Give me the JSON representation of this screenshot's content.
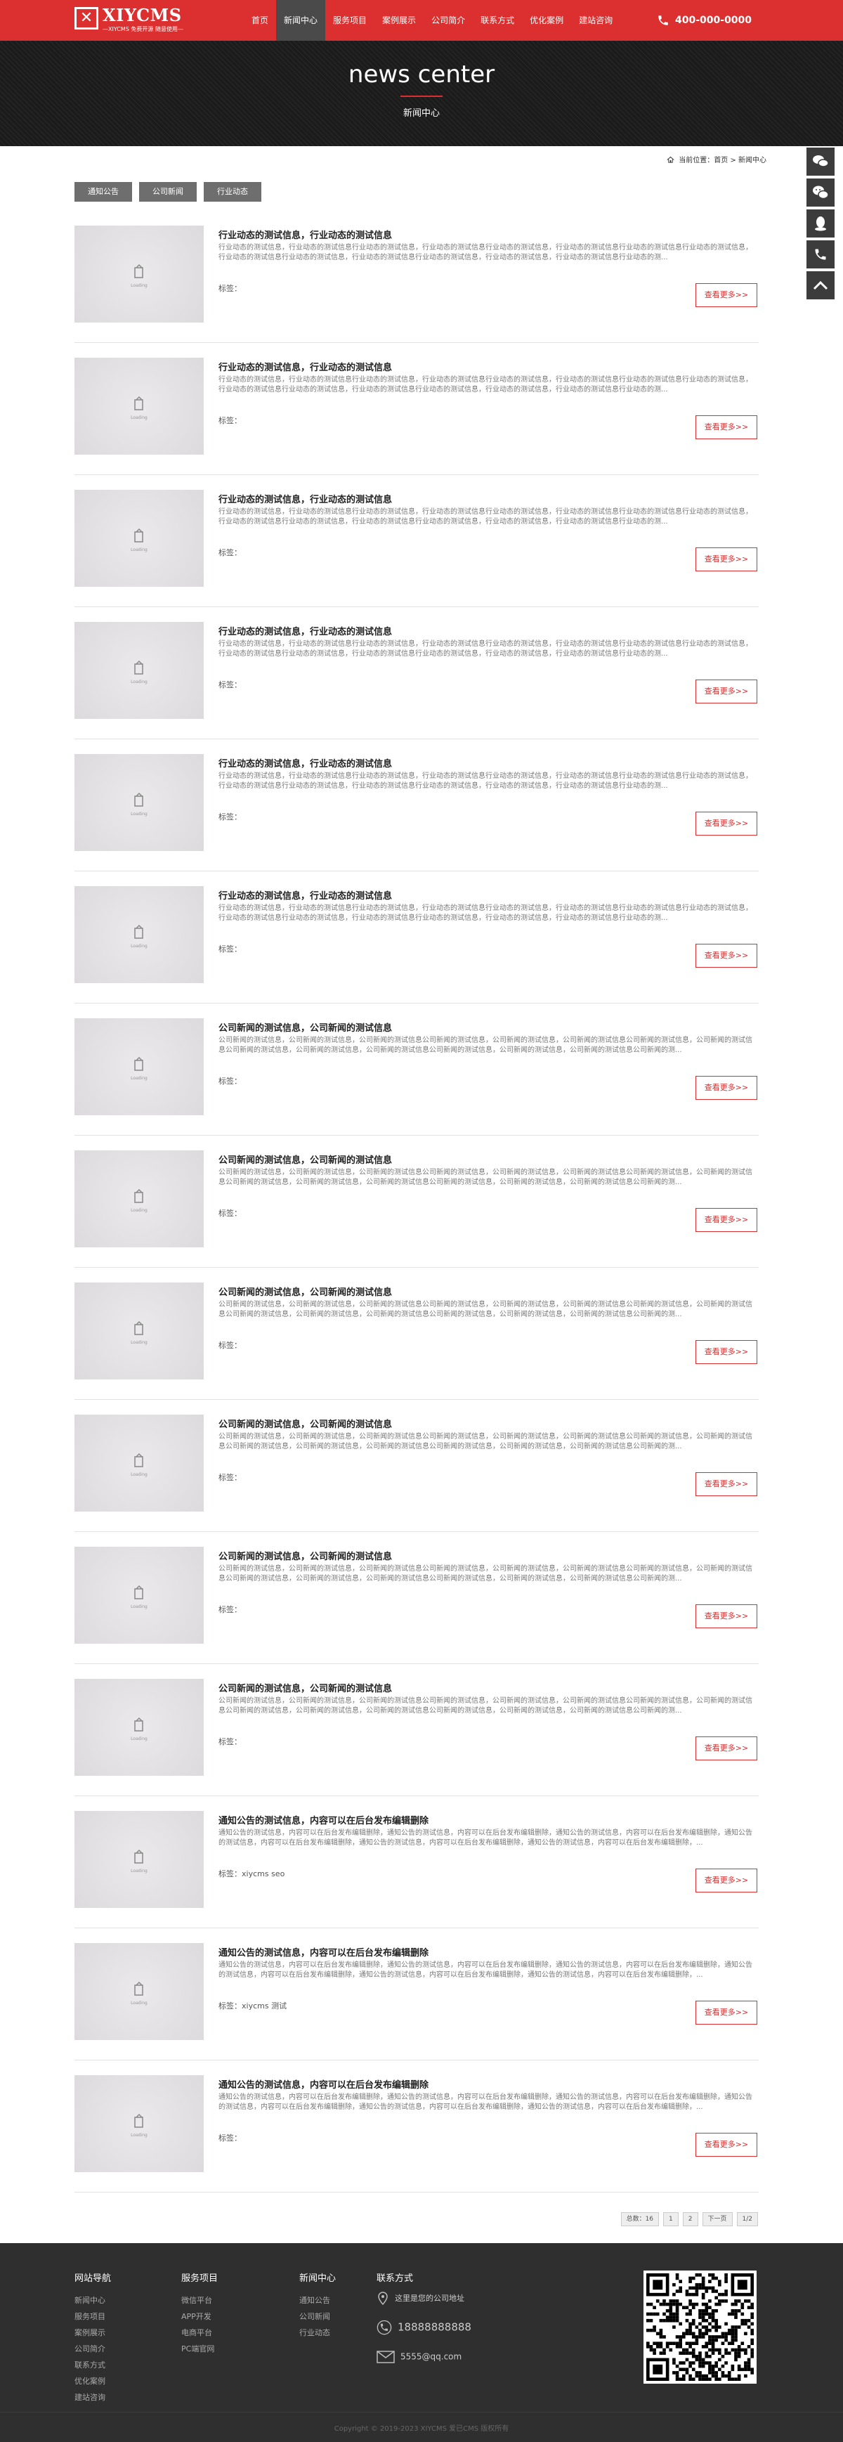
{
  "brand": {
    "logo_text": "XIYCMS",
    "logo_sub": "—XIYCMS 免费开源 随意使用—",
    "accent": "#dc2f2f"
  },
  "nav": [
    {
      "label": "首页",
      "active": false
    },
    {
      "label": "新闻中心",
      "active": true
    },
    {
      "label": "服务项目",
      "active": false
    },
    {
      "label": "案例展示",
      "active": false
    },
    {
      "label": "公司简介",
      "active": false
    },
    {
      "label": "联系方式",
      "active": false
    },
    {
      "label": "优化案例",
      "active": false
    },
    {
      "label": "建站咨询",
      "active": false
    }
  ],
  "header": {
    "phone": "400-000-0000"
  },
  "banner": {
    "title": "news center",
    "subtitle": "新闻中心"
  },
  "breadcrumb": {
    "text": "当前位置：首页 > 新闻中心"
  },
  "tabs": [
    "通知公告",
    "公司新闻",
    "行业动态"
  ],
  "thumb_caption": "Loading",
  "more_label": "查看更多>>",
  "articles": [
    {
      "title": "行业动态的测试信息，行业动态的测试信息",
      "desc": "行业动态的测试信息，行业动态的测试信息行业动态的测试信息，行业动态的测试信息行业动态的测试信息，行业动态的测试信息行业动态的测试信息行业动态的测试信息，行业动态的测试信息行业动态的测试信息，行业动态的测试信息行业动态的测试信息，行业动态的测试信息，行业动态的测试信息行业动态的测...",
      "tags": "标签："
    },
    {
      "title": "行业动态的测试信息，行业动态的测试信息",
      "desc": "行业动态的测试信息，行业动态的测试信息行业动态的测试信息，行业动态的测试信息行业动态的测试信息，行业动态的测试信息行业动态的测试信息行业动态的测试信息，行业动态的测试信息行业动态的测试信息，行业动态的测试信息行业动态的测试信息，行业动态的测试信息，行业动态的测试信息行业动态的测...",
      "tags": "标签："
    },
    {
      "title": "行业动态的测试信息，行业动态的测试信息",
      "desc": "行业动态的测试信息，行业动态的测试信息行业动态的测试信息，行业动态的测试信息行业动态的测试信息，行业动态的测试信息行业动态的测试信息行业动态的测试信息，行业动态的测试信息行业动态的测试信息，行业动态的测试信息行业动态的测试信息，行业动态的测试信息，行业动态的测试信息行业动态的测...",
      "tags": "标签："
    },
    {
      "title": "行业动态的测试信息，行业动态的测试信息",
      "desc": "行业动态的测试信息，行业动态的测试信息行业动态的测试信息，行业动态的测试信息行业动态的测试信息，行业动态的测试信息行业动态的测试信息行业动态的测试信息，行业动态的测试信息行业动态的测试信息，行业动态的测试信息行业动态的测试信息，行业动态的测试信息，行业动态的测试信息行业动态的测...",
      "tags": "标签："
    },
    {
      "title": "行业动态的测试信息，行业动态的测试信息",
      "desc": "行业动态的测试信息，行业动态的测试信息行业动态的测试信息，行业动态的测试信息行业动态的测试信息，行业动态的测试信息行业动态的测试信息行业动态的测试信息，行业动态的测试信息行业动态的测试信息，行业动态的测试信息行业动态的测试信息，行业动态的测试信息，行业动态的测试信息行业动态的测...",
      "tags": "标签："
    },
    {
      "title": "行业动态的测试信息，行业动态的测试信息",
      "desc": "行业动态的测试信息，行业动态的测试信息行业动态的测试信息，行业动态的测试信息行业动态的测试信息，行业动态的测试信息行业动态的测试信息行业动态的测试信息，行业动态的测试信息行业动态的测试信息，行业动态的测试信息行业动态的测试信息，行业动态的测试信息，行业动态的测试信息行业动态的测...",
      "tags": "标签："
    },
    {
      "title": "公司新闻的测试信息，公司新闻的测试信息",
      "desc": "公司新闻的测试信息，公司新闻的测试信息，公司新闻的测试信息公司新闻的测试信息，公司新闻的测试信息，公司新闻的测试信息公司新闻的测试信息，公司新闻的测试信息公司新闻的测试信息，公司新闻的测试信息，公司新闻的测试信息公司新闻的测试信息，公司新闻的测试信息，公司新闻的测试信息公司新闻的测...",
      "tags": "标签："
    },
    {
      "title": "公司新闻的测试信息，公司新闻的测试信息",
      "desc": "公司新闻的测试信息，公司新闻的测试信息，公司新闻的测试信息公司新闻的测试信息，公司新闻的测试信息，公司新闻的测试信息公司新闻的测试信息，公司新闻的测试信息公司新闻的测试信息，公司新闻的测试信息，公司新闻的测试信息公司新闻的测试信息，公司新闻的测试信息，公司新闻的测试信息公司新闻的测...",
      "tags": "标签："
    },
    {
      "title": "公司新闻的测试信息，公司新闻的测试信息",
      "desc": "公司新闻的测试信息，公司新闻的测试信息，公司新闻的测试信息公司新闻的测试信息，公司新闻的测试信息，公司新闻的测试信息公司新闻的测试信息，公司新闻的测试信息公司新闻的测试信息，公司新闻的测试信息，公司新闻的测试信息公司新闻的测试信息，公司新闻的测试信息，公司新闻的测试信息公司新闻的测...",
      "tags": "标签："
    },
    {
      "title": "公司新闻的测试信息，公司新闻的测试信息",
      "desc": "公司新闻的测试信息，公司新闻的测试信息，公司新闻的测试信息公司新闻的测试信息，公司新闻的测试信息，公司新闻的测试信息公司新闻的测试信息，公司新闻的测试信息公司新闻的测试信息，公司新闻的测试信息，公司新闻的测试信息公司新闻的测试信息，公司新闻的测试信息，公司新闻的测试信息公司新闻的测...",
      "tags": "标签："
    },
    {
      "title": "公司新闻的测试信息，公司新闻的测试信息",
      "desc": "公司新闻的测试信息，公司新闻的测试信息，公司新闻的测试信息公司新闻的测试信息，公司新闻的测试信息，公司新闻的测试信息公司新闻的测试信息，公司新闻的测试信息公司新闻的测试信息，公司新闻的测试信息，公司新闻的测试信息公司新闻的测试信息，公司新闻的测试信息，公司新闻的测试信息公司新闻的测...",
      "tags": "标签："
    },
    {
      "title": "公司新闻的测试信息，公司新闻的测试信息",
      "desc": "公司新闻的测试信息，公司新闻的测试信息，公司新闻的测试信息公司新闻的测试信息，公司新闻的测试信息，公司新闻的测试信息公司新闻的测试信息，公司新闻的测试信息公司新闻的测试信息，公司新闻的测试信息，公司新闻的测试信息公司新闻的测试信息，公司新闻的测试信息，公司新闻的测试信息公司新闻的测...",
      "tags": "标签："
    },
    {
      "title": "通知公告的测试信息，内容可以在后台发布编辑删除",
      "desc": "通知公告的测试信息，内容可以在后台发布编辑删除，通知公告的测试信息，内容可以在后台发布编辑删除，通知公告的测试信息，内容可以在后台发布编辑删除，通知公告的测试信息，内容可以在后台发布编辑删除，通知公告的测试信息，内容可以在后台发布编辑删除，通知公告的测试信息，内容可以在后台发布编辑删除，...",
      "tags": "标签：xiycms seo"
    },
    {
      "title": "通知公告的测试信息，内容可以在后台发布编辑删除",
      "desc": "通知公告的测试信息，内容可以在后台发布编辑删除，通知公告的测试信息，内容可以在后台发布编辑删除，通知公告的测试信息，内容可以在后台发布编辑删除，通知公告的测试信息，内容可以在后台发布编辑删除，通知公告的测试信息，内容可以在后台发布编辑删除，通知公告的测试信息，内容可以在后台发布编辑删除，...",
      "tags": "标签：xiycms 测试"
    },
    {
      "title": "通知公告的测试信息，内容可以在后台发布编辑删除",
      "desc": "通知公告的测试信息，内容可以在后台发布编辑删除，通知公告的测试信息，内容可以在后台发布编辑删除，通知公告的测试信息，内容可以在后台发布编辑删除，通知公告的测试信息，内容可以在后台发布编辑删除，通知公告的测试信息，内容可以在后台发布编辑删除，通知公告的测试信息，内容可以在后台发布编辑删除，...",
      "tags": "标签："
    }
  ],
  "pagination": [
    "总数：16",
    "1",
    "2",
    "下一页",
    "1/2"
  ],
  "side_tools": [
    {
      "icon": "chat-bubbles-icon"
    },
    {
      "icon": "wechat-icon"
    },
    {
      "icon": "qq-icon"
    },
    {
      "icon": "phone-icon"
    },
    {
      "icon": "back-to-top-icon"
    }
  ],
  "footer": {
    "columns": [
      {
        "title": "网站导航",
        "links": [
          "新闻中心",
          "服务项目",
          "案例展示",
          "公司简介",
          "联系方式",
          "优化案例",
          "建站咨询"
        ]
      },
      {
        "title": "服务项目",
        "links": [
          "微信平台",
          "APP开发",
          "电商平台",
          "PC端官网"
        ]
      },
      {
        "title": "新闻中心",
        "links": [
          "通知公告",
          "公司新闻",
          "行业动态"
        ]
      }
    ],
    "contact_title": "联系方式",
    "address": "这里是您的公司地址",
    "phone": "18888888888",
    "email": "5555@qq.com",
    "copyright": "Copyright © 2019-2023 XIYCMS 爱已CMS 版权所有"
  }
}
